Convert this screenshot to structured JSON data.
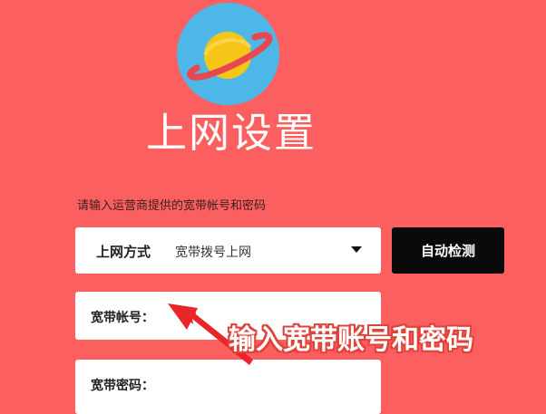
{
  "page": {
    "title": "上网设置",
    "instruction": "请输入运营商提供的宽带帐号和密码"
  },
  "connection": {
    "label": "上网方式",
    "value": "宽带拨号上网"
  },
  "detect_button": {
    "label": "自动检测"
  },
  "account": {
    "label": "宽带帐号："
  },
  "password": {
    "label": "宽带密码："
  },
  "annotation": {
    "text": "输入宽带账号和密码"
  },
  "icons": {
    "logo": "planet-icon",
    "dropdown": "caret-down-icon",
    "pointer": "arrow-pointer-icon"
  },
  "colors": {
    "background": "#fb5f5f",
    "logo_circle": "#4db8e8",
    "planet": "#f5c518",
    "ring": "#e8474f",
    "button": "#0a0a0a",
    "arrow": "#e8262a"
  }
}
